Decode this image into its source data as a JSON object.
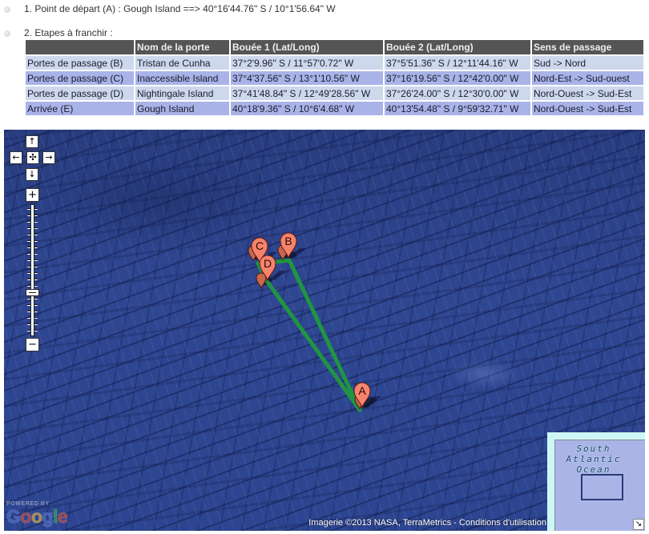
{
  "steps": [
    "1. Point de départ (A) : Gough Island ==> 40°16'44.76\" S / 10°1'56.64\" W",
    "2. Etapes à franchir :"
  ],
  "table": {
    "headers": [
      "",
      "Nom de la porte",
      "Bouée 1 (Lat/Long)",
      "Bouée 2 (Lat/Long)",
      "Sens de passage"
    ],
    "rows": [
      [
        "Portes de passage (B)",
        "Tristan de Cunha",
        "37°2'9.96\" S / 11°57'0.72\" W",
        "37°5'51.36\" S / 12°11'44.16\" W",
        "Sud -> Nord"
      ],
      [
        "Portes de passage (C)",
        "Inaccessible Island",
        "37°4'37.56\" S / 13°1'10.56\" W",
        "37°16'19.56\" S / 12°42'0.00\" W",
        "Nord-Est -> Sud-ouest"
      ],
      [
        "Portes de passage (D)",
        "Nightingale Island",
        "37°41'48.84\" S / 12°49'28.56\" W",
        "37°26'24.00\" S / 12°30'0.00\" W",
        "Nord-Ouest -> Sud-Est"
      ],
      [
        "Arrivée (E)",
        "Gough Island",
        "40°18'9.36\" S / 10°6'4.68\" W",
        "40°13'54.48\" S / 9°59'32.71\" W",
        "Nord-Ouest -> Sud-Est"
      ]
    ]
  },
  "map": {
    "markers": [
      {
        "label": "A"
      },
      {
        "label": "B"
      },
      {
        "label": "C"
      },
      {
        "label": "D"
      }
    ],
    "controls": {
      "pan_up": {
        "icon": "arrow-up-icon",
        "glyph": "↑"
      },
      "pan_left": {
        "icon": "arrow-left-icon",
        "glyph": "←"
      },
      "pan_reset": {
        "icon": "center-reset-icon",
        "glyph": "✣"
      },
      "pan_right": {
        "icon": "arrow-right-icon",
        "glyph": "→"
      },
      "pan_down": {
        "icon": "arrow-down-icon",
        "glyph": "↓"
      },
      "zoom_in": {
        "icon": "plus-icon",
        "glyph": "+"
      },
      "zoom_out": {
        "icon": "minus-icon",
        "glyph": "−"
      }
    },
    "zoom": {
      "level": 6,
      "min": 0,
      "max": 19
    },
    "overview": {
      "label": [
        "South",
        "Atlantic",
        "Ocean"
      ],
      "toggle": {
        "icon": "collapse-arrow-icon",
        "glyph": "↘"
      }
    },
    "attribution": {
      "text": "Imagerie ©2013 NASA, TerraMetrics - ",
      "terms_link": "Conditions d'utilisation"
    },
    "logo": {
      "powered_by": "POWERED BY",
      "letters": [
        "G",
        "o",
        "o",
        "g",
        "l",
        "e"
      ]
    }
  },
  "colors": {
    "table_header_bg": "#555555",
    "row_light": "#cdd8ed",
    "row_dark": "#a9b3e8",
    "route": "#1f9a3e",
    "marker": "#f6836c",
    "marker_small": "#c8664f",
    "water": "#2e4590"
  }
}
